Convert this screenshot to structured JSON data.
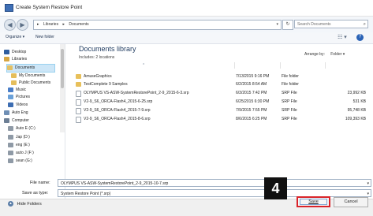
{
  "window": {
    "title": "Create System Restore Point"
  },
  "addressbar": {
    "path": [
      "Libraries",
      "Documents"
    ],
    "sep": "▸",
    "search_placeholder": "Search Documents"
  },
  "toolbar": {
    "organize": "Organize ▾",
    "new_folder": "New folder"
  },
  "sidebar": {
    "items": [
      {
        "label": "Desktop",
        "icon": "desktop-icon",
        "color": "#2f5d9e"
      },
      {
        "label": "Libraries",
        "icon": "libraries-icon",
        "color": "#d7a642"
      },
      {
        "label": "Documents",
        "icon": "documents-icon",
        "color": "#e2c065",
        "selected": true
      },
      {
        "label": "My Documents",
        "icon": "folder-icon",
        "color": "#e5be5c"
      },
      {
        "label": "Public Documents",
        "icon": "folder-icon",
        "color": "#e5be5c"
      },
      {
        "label": "Music",
        "icon": "music-icon",
        "color": "#4a7ec8"
      },
      {
        "label": "Pictures",
        "icon": "pictures-icon",
        "color": "#6aa0d8"
      },
      {
        "label": "Videos",
        "icon": "videos-icon",
        "color": "#3d6db2"
      },
      {
        "label": "Auto Eng",
        "icon": "user-folder-icon",
        "color": "#6f8fb5"
      },
      {
        "label": "Computer",
        "icon": "computer-icon",
        "color": "#6d7f95"
      },
      {
        "label": "Auto E (C:)",
        "icon": "drive-icon",
        "color": "#8f9aa6"
      },
      {
        "label": "Jap (D:)",
        "icon": "drive-icon",
        "color": "#8f9aa6"
      },
      {
        "label": "eng (E:)",
        "icon": "drive-icon",
        "color": "#8f9aa6"
      },
      {
        "label": "auto J (F:)",
        "icon": "drive-icon",
        "color": "#8f9aa6"
      },
      {
        "label": "sean (G:)",
        "icon": "drive-icon",
        "color": "#8f9aa6"
      }
    ]
  },
  "library": {
    "title": "Documents library",
    "subtitle": "Includes: 2 locations",
    "arrange_label": "Arrange by:",
    "arrange_value": "Folder ▾"
  },
  "files": [
    {
      "name": "AmuseGraphics",
      "date": "7/13/2015 9:16 PM",
      "type": "File folder",
      "size": "",
      "kind": "folder"
    },
    {
      "name": "TestComplete 9 Samples",
      "date": "6/2/2015 8:54 AM",
      "type": "File folder",
      "size": "",
      "kind": "folder"
    },
    {
      "name": "OLYMPUS VS-ASW-SystemRestorePoint_2-9_2015-6-3.srp",
      "date": "6/3/2015 7:42 PM",
      "type": "SRP File",
      "size": "23,992 KB",
      "kind": "file"
    },
    {
      "name": "V2-9_S6_ORCA-Flash4_2015-6-25.srp",
      "date": "6/25/2015 6:30 PM",
      "type": "SRP File",
      "size": "531 KB",
      "kind": "file"
    },
    {
      "name": "V2-9_S6_ORCA-Flash4_2015-7-9.srp",
      "date": "7/9/2015 7:55 PM",
      "type": "SRP File",
      "size": "95,748 KB",
      "kind": "file"
    },
    {
      "name": "V2-9_S6_ORCA-Flash4_2015-8-6.srp",
      "date": "8/6/2015 6:25 PM",
      "type": "SRP File",
      "size": "109,393 KB",
      "kind": "file"
    }
  ],
  "form": {
    "filename_label": "File name:",
    "filename_value": "OLYMPUS VS-ASW-SystemRestorePoint_2-9_2015-10-7.srp",
    "savetype_label": "Save as type:",
    "savetype_value": "System Restore Point (*.srp)"
  },
  "footer": {
    "hide_folders": "Hide Folders",
    "save": "Save",
    "cancel": "Cancel",
    "step_number": "4"
  }
}
